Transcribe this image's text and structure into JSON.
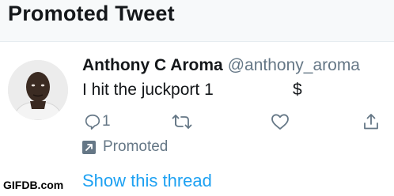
{
  "header": {
    "title": "Promoted Tweet"
  },
  "tweet": {
    "author_name": "Anthony C Aroma",
    "author_handle": "@anthony_aroma",
    "text": "I hit the juckport 1",
    "text_symbol": "$",
    "reply_count": "1",
    "promoted_label": "Promoted",
    "show_thread": "Show this thread"
  },
  "watermark": "GIFDB.com",
  "icons": {
    "reply": "reply-icon",
    "retweet": "retweet-icon",
    "like": "heart-icon",
    "share": "share-icon",
    "promoted": "promoted-arrow-icon"
  },
  "colors": {
    "text_primary": "#14171a",
    "text_secondary": "#657786",
    "link": "#1da1f2",
    "header_bg": "#f7f9fa"
  }
}
